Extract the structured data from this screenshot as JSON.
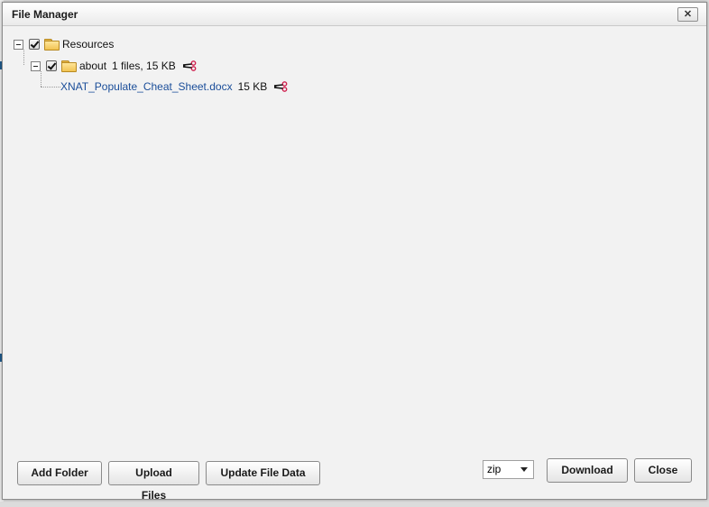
{
  "dialog": {
    "title": "File Manager",
    "close_glyph": "✕"
  },
  "tree": {
    "root": {
      "label": "Resources",
      "checked": true,
      "icon": "folder-icon"
    },
    "folder": {
      "label": "about",
      "meta": "1 files, 15 KB",
      "checked": true,
      "icon": "folder-icon"
    },
    "file": {
      "name": "XNAT_Populate_Cheat_Sheet.docx",
      "size": "15 KB"
    }
  },
  "footer": {
    "add_folder": "Add Folder",
    "upload_files": "Upload Files",
    "update_file_data": "Update File Data",
    "format_selected": "zip",
    "download": "Download",
    "close": "Close"
  },
  "colors": {
    "link": "#1a4d99",
    "scissors": "#d0214f",
    "folder": "#f1c352"
  }
}
